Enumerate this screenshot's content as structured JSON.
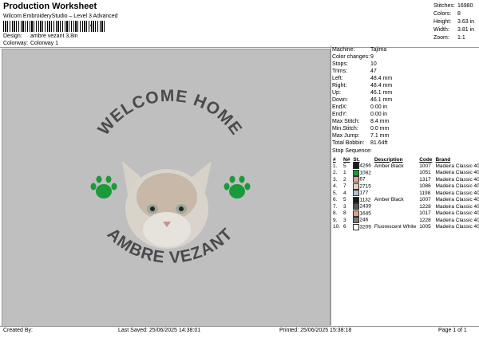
{
  "header": {
    "title": "Production Worksheet",
    "subtitle": "Wilcom EmbroideryStudio – Level 3 Advanced",
    "design_label": "Design:",
    "design_value": "ambre vezant 3,8in",
    "colorway_label": "Colorway:",
    "colorway_value": "Colorway 1"
  },
  "stats": [
    {
      "label": "Stitches:",
      "value": "16980"
    },
    {
      "label": "Colors:",
      "value": "8"
    },
    {
      "label": "Height:",
      "value": "3.63 in"
    },
    {
      "label": "Width:",
      "value": "3.81 in"
    },
    {
      "label": "Zoom:",
      "value": "1:1"
    }
  ],
  "design": {
    "top_text": "WELCOME HOME",
    "bottom_text": "AMBRE VEZANT",
    "paw_color": "#1a9a3a",
    "text_color": "#4a4a4a"
  },
  "machine": [
    {
      "label": "Machine:",
      "value": "Tajima"
    },
    {
      "label": "Color changes:",
      "value": "9"
    },
    {
      "label": "Stops:",
      "value": "10"
    },
    {
      "label": "Trims:",
      "value": "47"
    },
    {
      "label": "Left:",
      "value": "48.4 mm"
    },
    {
      "label": "Right:",
      "value": "48.4 mm"
    },
    {
      "label": "Up:",
      "value": "46.1 mm"
    },
    {
      "label": "Down:",
      "value": "46.1 mm"
    },
    {
      "label": "EndX:",
      "value": "0.00 in"
    },
    {
      "label": "EndY:",
      "value": "0.00 in"
    },
    {
      "label": "Max Stitch:",
      "value": "8.4 mm"
    },
    {
      "label": "Min.Stitch:",
      "value": "0.0 mm"
    },
    {
      "label": "Max Jump:",
      "value": "7.1 mm"
    },
    {
      "label": "Total Bobbin:",
      "value": "81.64ft"
    }
  ],
  "sequence": {
    "heading": "Stop Sequence:",
    "columns": [
      "#",
      "N#",
      "St.",
      "Description",
      "Code",
      "Brand"
    ],
    "rows": [
      {
        "num": "1.",
        "n": "5",
        "color": "#1a1a1a",
        "st": "4266",
        "desc": "Amber Black",
        "code": "1007",
        "brand": "Madeira Classic 40"
      },
      {
        "num": "2.",
        "n": "1",
        "color": "#1a9a3a",
        "st": "1082",
        "desc": "",
        "code": "1051",
        "brand": "Madeira Classic 40"
      },
      {
        "num": "3.",
        "n": "2",
        "color": "#e8a090",
        "st": "67",
        "desc": "",
        "code": "1317",
        "brand": "Madeira Classic 40"
      },
      {
        "num": "4.",
        "n": "7",
        "color": "#e0d0c0",
        "st": "2715",
        "desc": "",
        "code": "1086",
        "brand": "Madeira Classic 40"
      },
      {
        "num": "5.",
        "n": "4",
        "color": "#b0c0d0",
        "st": "177",
        "desc": "",
        "code": "1198",
        "brand": "Madeira Classic 40"
      },
      {
        "num": "6.",
        "n": "5",
        "color": "#1a1a1a",
        "st": "1132",
        "desc": "Amber Black",
        "code": "1007",
        "brand": "Madeira Classic 40"
      },
      {
        "num": "7.",
        "n": "3",
        "color": "#555555",
        "st": "2439",
        "desc": "",
        "code": "1228",
        "brand": "Madeira Classic 40"
      },
      {
        "num": "8.",
        "n": "8",
        "color": "#e89a80",
        "st": "1645",
        "desc": "",
        "code": "1017",
        "brand": "Madeira Classic 40"
      },
      {
        "num": "9.",
        "n": "3",
        "color": "#777777",
        "st": "246",
        "desc": "",
        "code": "1228",
        "brand": "Madeira Classic 40"
      },
      {
        "num": "10.",
        "n": "6",
        "color": "#ffffff",
        "st": "3209",
        "desc": "Fluorescent White",
        "code": "1005",
        "brand": "Madeira Classic 40"
      }
    ]
  },
  "footer": {
    "created_by": "Created By:",
    "last_saved": "Last Saved: 25/06/2025 14:38:01",
    "printed": "Printed: 25/06/2025 15:38:18",
    "page": "Page 1 of 1"
  }
}
